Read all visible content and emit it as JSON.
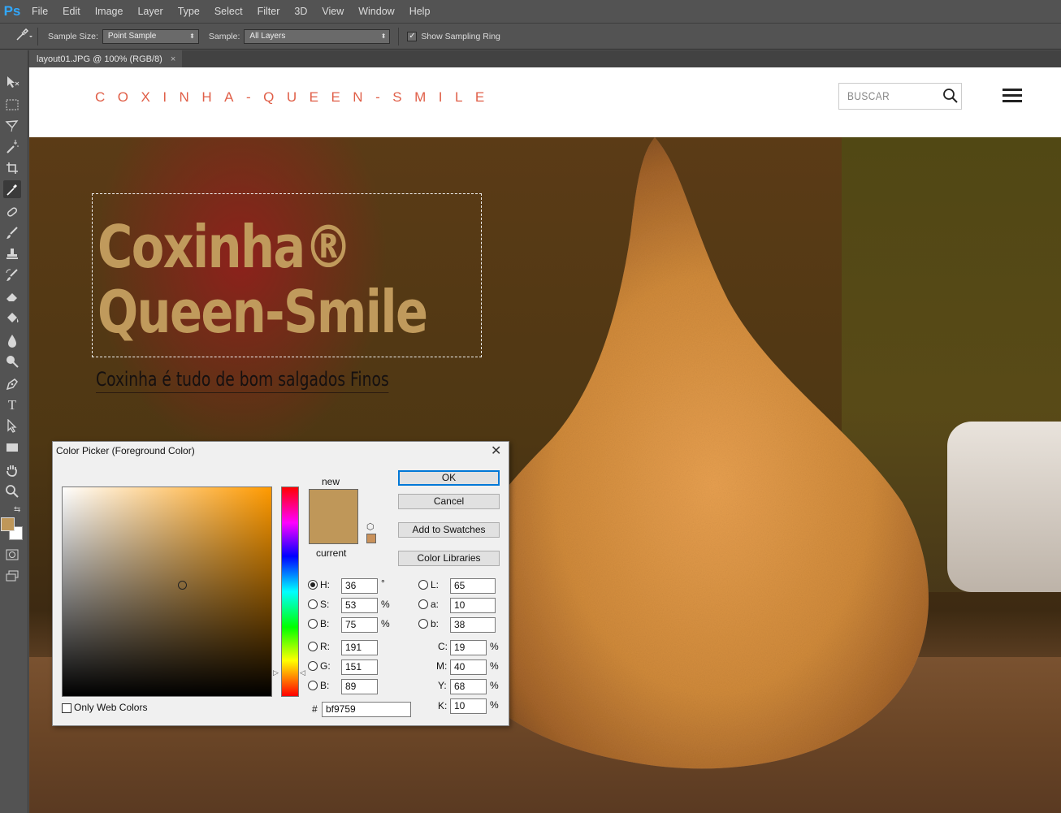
{
  "app": {
    "logo": "Ps"
  },
  "menu": [
    "File",
    "Edit",
    "Image",
    "Layer",
    "Type",
    "Select",
    "Filter",
    "3D",
    "View",
    "Window",
    "Help"
  ],
  "options": {
    "sample_size_label": "Sample Size:",
    "sample_size_value": "Point Sample",
    "sample_label": "Sample:",
    "sample_value": "All Layers",
    "show_ring_label": "Show Sampling Ring",
    "show_ring_checked": true
  },
  "document": {
    "tab_title": "layout01.JPG @ 100% (RGB/8)",
    "close": "×"
  },
  "website": {
    "brand": "COXINHA-QUEEN-SMILE",
    "search_placeholder": "BUSCAR",
    "hero_title_line1": "Coxinha®",
    "hero_title_line2": "Queen-Smile",
    "hero_subtitle": "Coxinha é tudo de bom salgados Finos",
    "brand_color": "#e05f48",
    "hero_title_color": "#c09a5c"
  },
  "tools": [
    "move-icon",
    "marquee-icon",
    "lasso-icon",
    "magic-wand-icon",
    "crop-icon",
    "eyedropper-icon",
    "healing-brush-icon",
    "brush-icon",
    "clone-stamp-icon",
    "history-brush-icon",
    "eraser-icon",
    "paint-bucket-icon",
    "blur-icon",
    "dodge-icon",
    "pen-icon",
    "type-icon",
    "path-selection-icon",
    "rectangle-icon",
    "hand-icon",
    "zoom-icon"
  ],
  "foreground_color": "#bf9759",
  "color_picker": {
    "title": "Color Picker (Foreground Color)",
    "close": "✕",
    "new_label": "new",
    "current_label": "current",
    "buttons": {
      "ok": "OK",
      "cancel": "Cancel",
      "add_swatches": "Add to Swatches",
      "color_libraries": "Color Libraries"
    },
    "hsb": {
      "H_label": "H:",
      "H": "36",
      "H_unit": "°",
      "S_label": "S:",
      "S": "53",
      "S_unit": "%",
      "B_label": "B:",
      "B": "75",
      "B_unit": "%"
    },
    "rgb": {
      "R_label": "R:",
      "R": "191",
      "G_label": "G:",
      "G": "151",
      "B_label": "B:",
      "B": "89"
    },
    "lab": {
      "L_label": "L:",
      "L": "65",
      "a_label": "a:",
      "a": "10",
      "b_label": "b:",
      "b": "38"
    },
    "cmyk": {
      "C_label": "C:",
      "C": "19",
      "M_label": "M:",
      "M": "40",
      "Y_label": "Y:",
      "Y": "68",
      "K_label": "K:",
      "K": "10",
      "unit": "%"
    },
    "hex_label": "#",
    "hex": "bf9759",
    "only_web_colors_label": "Only Web Colors",
    "only_web_colors_checked": false,
    "new_color": "#bf9759",
    "current_color": "#bf9759"
  }
}
